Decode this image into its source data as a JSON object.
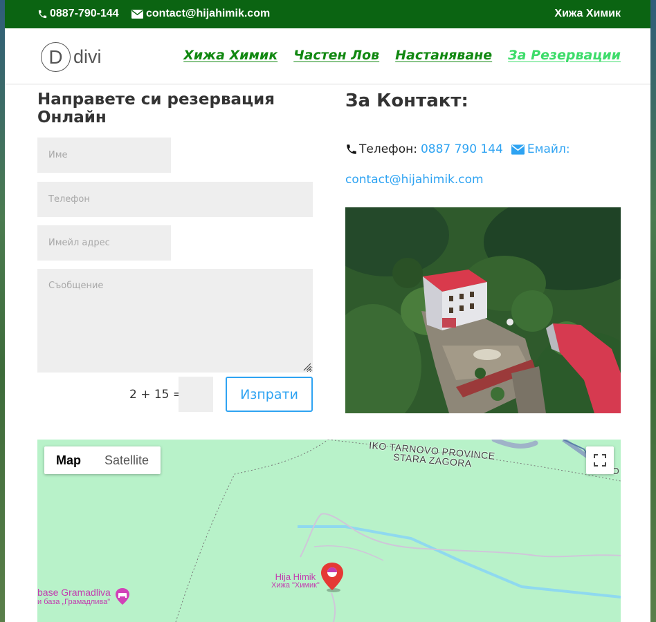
{
  "topbar": {
    "phone": "0887-790-144",
    "email": "contact@hijahimik.com",
    "brand": "Хижа Химик",
    "background": "#0b6412"
  },
  "header": {
    "logo_letter": "D",
    "logo_text": "divi",
    "nav": [
      {
        "label": "Хижа Химик",
        "active": false
      },
      {
        "label": "Частен Лов",
        "active": false
      },
      {
        "label": "Настаняване",
        "active": false
      },
      {
        "label": "За Резервации",
        "active": true
      }
    ],
    "nav_color": "#118811",
    "nav_active_color": "#3ddc6a"
  },
  "form": {
    "title": "Направете си резервация Онлайн",
    "name_placeholder": "Име",
    "phone_placeholder": "Телефон",
    "email_placeholder": "Имейл адрес",
    "message_placeholder": "Съобщение",
    "captcha": "2 + 15 =",
    "submit_label": "Изпрати",
    "accent": "#2ea3f2"
  },
  "contact": {
    "title": "За Контакт:",
    "phone_label": "Телефон:",
    "phone_value": "0887 790 144",
    "email_label": "Емайл:",
    "email_value": "contact@hijahimik.com"
  },
  "photo": {
    "alt": "Хижа Химик"
  },
  "map": {
    "type_map": "Map",
    "type_satellite": "Satellite",
    "province1": "IKO TARNOVO PROVINCE",
    "province2": "STARA ZAGORA",
    "edge_label": "ELKO",
    "poi_main_name": "Hija Himik",
    "poi_main_local": "Хижа \"Химик\"",
    "poi_second_name": "base Gramadliva",
    "poi_second_local": "и база „Грамадлива\""
  }
}
